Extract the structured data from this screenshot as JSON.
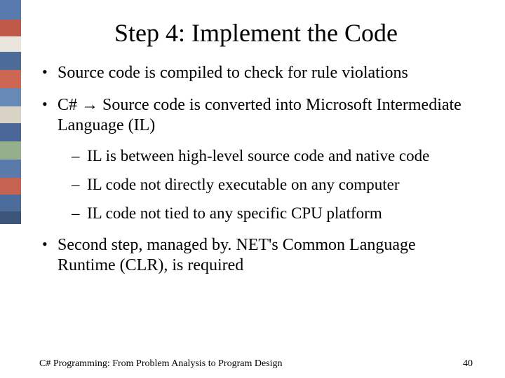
{
  "title": "Step 4: Implement the Code",
  "bullets": {
    "b1": "Source code is compiled to check for rule violations",
    "b2": "C# → Source code is converted into Microsoft Intermediate Language (IL)",
    "sub1": "IL is between high-level source code and native code",
    "sub2": "IL code not directly executable on any computer",
    "sub3": "IL code not tied to any specific CPU platform",
    "b3": "Second step, managed by. NET's Common Language Runtime (CLR), is required"
  },
  "footer": {
    "source": "C# Programming: From Problem Analysis to Program Design",
    "page": "40"
  }
}
